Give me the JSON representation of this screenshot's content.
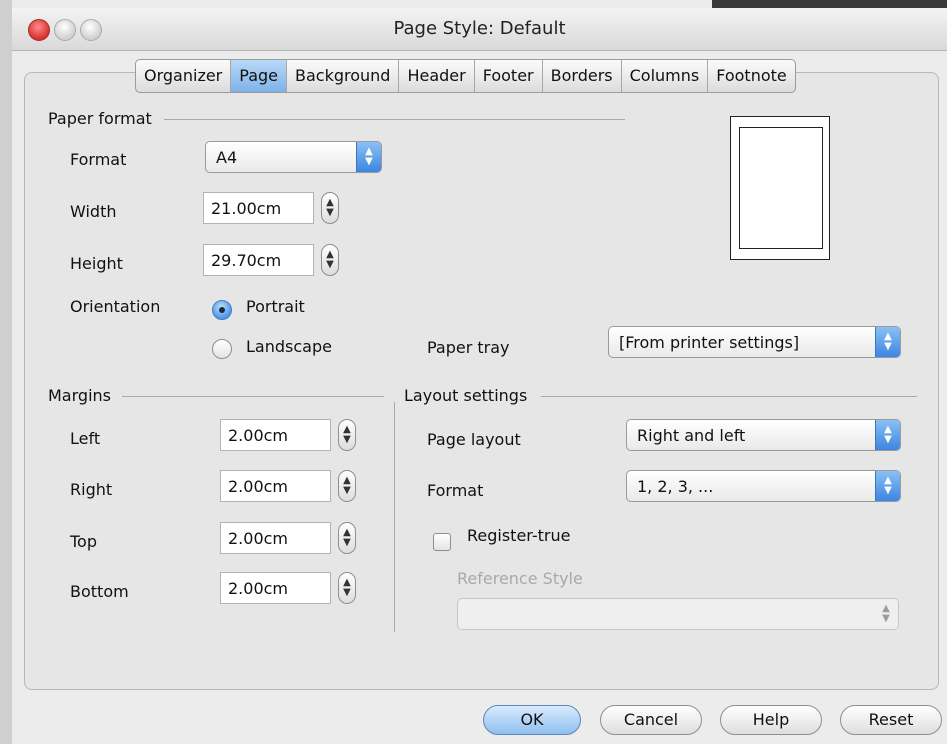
{
  "window": {
    "title": "Page Style: Default"
  },
  "tabs": [
    "Organizer",
    "Page",
    "Background",
    "Header",
    "Footer",
    "Borders",
    "Columns",
    "Footnote"
  ],
  "active_tab": "Page",
  "paper_format": {
    "section_label": "Paper format",
    "format_label": "Format",
    "format_value": "A4",
    "width_label": "Width",
    "width_value": "21.00cm",
    "height_label": "Height",
    "height_value": "29.70cm",
    "orientation_label": "Orientation",
    "portrait_label": "Portrait",
    "landscape_label": "Landscape",
    "orientation_selected": "Portrait",
    "paper_tray_label": "Paper tray",
    "paper_tray_value": "[From printer settings]"
  },
  "margins": {
    "section_label": "Margins",
    "left_label": "Left",
    "left_value": "2.00cm",
    "right_label": "Right",
    "right_value": "2.00cm",
    "top_label": "Top",
    "top_value": "2.00cm",
    "bottom_label": "Bottom",
    "bottom_value": "2.00cm"
  },
  "layout": {
    "section_label": "Layout settings",
    "page_layout_label": "Page layout",
    "page_layout_value": "Right and left",
    "format_label": "Format",
    "format_value": "1, 2, 3, ...",
    "register_true_label": "Register-true",
    "register_true_checked": false,
    "reference_style_label": "Reference Style",
    "reference_style_value": ""
  },
  "buttons": {
    "ok": "OK",
    "cancel": "Cancel",
    "help": "Help",
    "reset": "Reset"
  },
  "colors": {
    "accent": "#4a90e2",
    "tab_active": "#9fc8f2",
    "close": "#d8312c"
  },
  "icons": {
    "stepper": "up-down-arrows",
    "select": "up-down-arrows"
  }
}
